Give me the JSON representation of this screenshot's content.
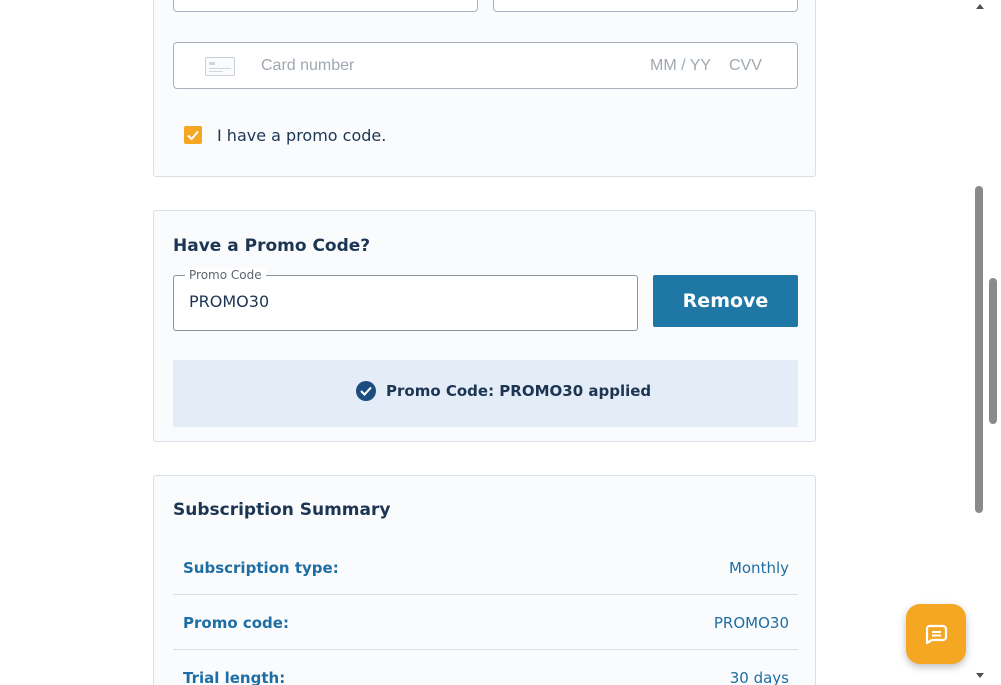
{
  "payment": {
    "card_placeholder": "Card number",
    "exp_placeholder": "MM / YY",
    "cvv_placeholder": "CVV",
    "promo_checkbox_label": "I have a promo code.",
    "promo_checkbox_checked": true
  },
  "promo": {
    "title": "Have a Promo Code?",
    "field_label": "Promo Code",
    "field_value": "PROMO30",
    "remove_label": "Remove",
    "applied_message": "Promo Code: PROMO30 applied"
  },
  "summary": {
    "title": "Subscription Summary",
    "rows": [
      {
        "label": "Subscription type:",
        "value": "Monthly"
      },
      {
        "label": "Promo code:",
        "value": "PROMO30"
      },
      {
        "label": "Trial length:",
        "value": "30 days"
      }
    ]
  },
  "icons": {
    "card": "credit-card-icon",
    "check": "check-icon",
    "applied": "check-circle-icon",
    "chat": "chat-icon"
  },
  "colors": {
    "accent_orange": "#f5a623",
    "button_blue": "#1f77a5",
    "banner_bg": "#e3ecf7",
    "text_navy": "#1c3553",
    "link_blue": "#1f6ea3"
  }
}
